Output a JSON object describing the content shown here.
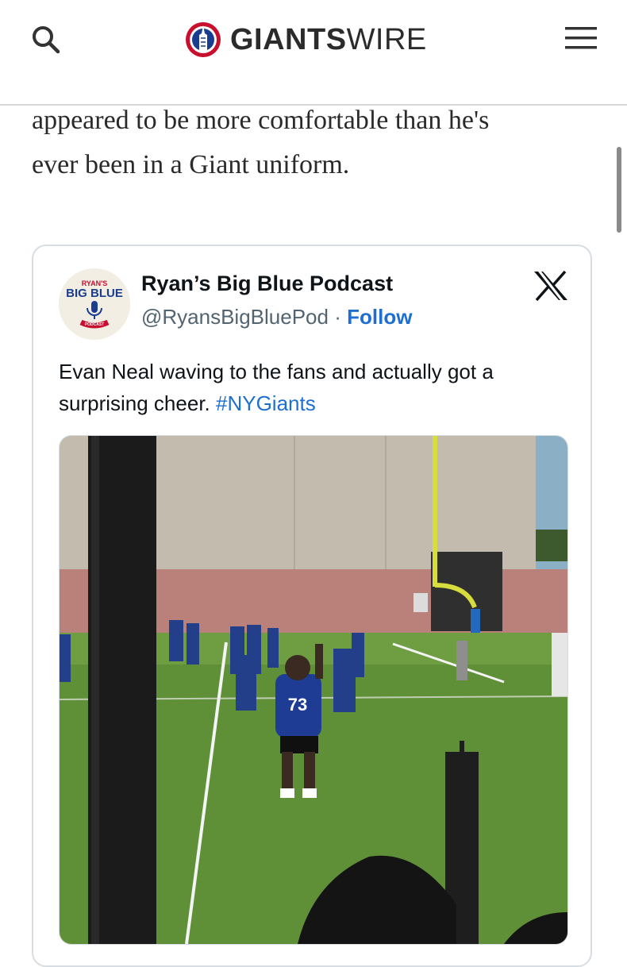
{
  "header": {
    "brand_bold": "GIANTS",
    "brand_light": "WIRE",
    "icons": {
      "search": "search-icon",
      "menu": "hamburger-menu-icon",
      "logo": "giantswire-logo-icon"
    }
  },
  "article": {
    "line1": "appeared to be more comfortable than he's",
    "line2": "ever been in a Giant uniform."
  },
  "embed": {
    "author_name": "Ryan’s Big Blue Podcast",
    "handle": "@RyansBigBluePod",
    "separator": "·",
    "follow_label": "Follow",
    "avatar": {
      "top_text": "RYAN'S",
      "main_text": "BIG BLUE",
      "bottom_text": "PODCAST"
    },
    "platform_icon": "x-logo-icon",
    "text": "Evan Neal waving to the fans and actually got a surprising cheer.",
    "hashtag": "#NYGiants",
    "media": {
      "jersey_number": "73",
      "description_icon": "practice-field-photo"
    }
  },
  "colors": {
    "brand_red": "#c8102e",
    "brand_blue": "#1b3d8f",
    "link_blue": "#1d6fd1",
    "text_dark": "#0f1419",
    "text_muted": "#536471"
  }
}
